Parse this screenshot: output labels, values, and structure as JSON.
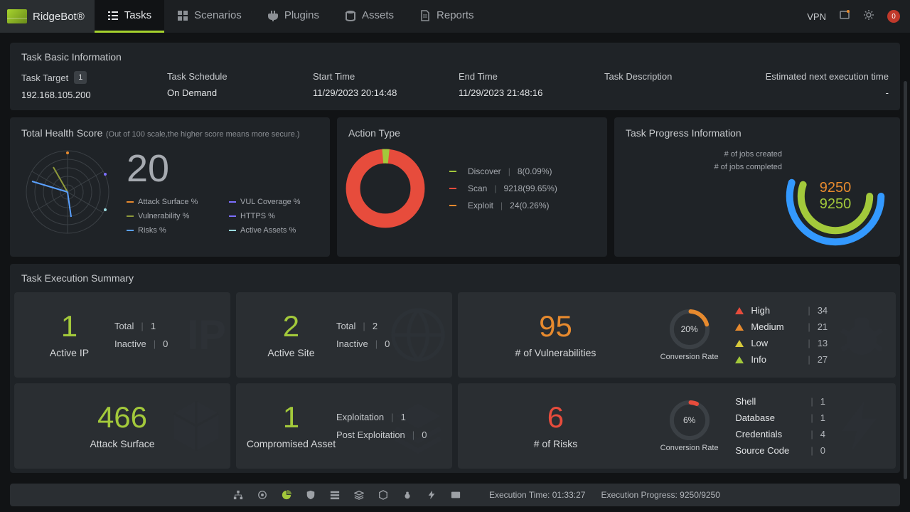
{
  "brand": "RidgeBot®",
  "nav": {
    "tasks": "Tasks",
    "scenarios": "Scenarios",
    "plugins": "Plugins",
    "assets": "Assets",
    "reports": "Reports",
    "vpn": "VPN",
    "avatar_initial": "0"
  },
  "basic": {
    "title": "Task Basic Information",
    "target_label": "Task Target",
    "target_count": "1",
    "target_value": "192.168.105.200",
    "schedule_label": "Task Schedule",
    "schedule_value": "On Demand",
    "start_label": "Start Time",
    "start_value": "11/29/2023 20:14:48",
    "end_label": "End Time",
    "end_value": "11/29/2023 21:48:16",
    "desc_label": "Task Description",
    "desc_value": "",
    "eta_label": "Estimated next execution time",
    "eta_value": "-"
  },
  "health": {
    "title": "Total Health Score",
    "subtitle": "(Out of 100 scale,the higher score means more secure.)",
    "score": "20",
    "legend": {
      "attack_surface": "Attack Surface %",
      "vul_coverage": "VUL Coverage %",
      "vulnerability": "Vulnerability %",
      "https": "HTTPS %",
      "risks": "Risks %",
      "active_assets": "Active Assets %"
    }
  },
  "action": {
    "title": "Action Type",
    "discover_label": "Discover",
    "discover_value": "8(0.09%)",
    "scan_label": "Scan",
    "scan_value": "9218(99.65%)",
    "exploit_label": "Exploit",
    "exploit_value": "24(0.26%)"
  },
  "progress": {
    "title": "Task Progress Information",
    "created_label": "# of jobs created",
    "completed_label": "# of jobs completed",
    "n_created": "9250",
    "n_completed": "9250"
  },
  "exec": {
    "title": "Task Execution Summary",
    "active_ip": {
      "big": "1",
      "label": "Active IP",
      "total_label": "Total",
      "total": "1",
      "inactive_label": "Inactive",
      "inactive": "0"
    },
    "active_site": {
      "big": "2",
      "label": "Active Site",
      "total_label": "Total",
      "total": "2",
      "inactive_label": "Inactive",
      "inactive": "0"
    },
    "vuln": {
      "big": "95",
      "label": "# of Vulnerabilities",
      "conv_pct": "20%",
      "conv_label": "Conversion Rate",
      "high_label": "High",
      "high": "34",
      "medium_label": "Medium",
      "medium": "21",
      "low_label": "Low",
      "low": "13",
      "info_label": "Info",
      "info": "27"
    },
    "attack_surface": {
      "big": "466",
      "label": "Attack Surface"
    },
    "compromised": {
      "big": "1",
      "label": "Compromised Asset",
      "exploit_label": "Exploitation",
      "exploit": "1",
      "post_label": "Post Exploitation",
      "post": "0"
    },
    "risks": {
      "big": "6",
      "label": "# of Risks",
      "conv_pct": "6%",
      "conv_label": "Conversion Rate",
      "shell_label": "Shell",
      "shell": "1",
      "db_label": "Database",
      "db": "1",
      "cred_label": "Credentials",
      "cred": "4",
      "src_label": "Source Code",
      "src": "0"
    }
  },
  "bottom": {
    "exec_time_label": "Execution Time:",
    "exec_time": "01:33:27",
    "progress_label": "Execution Progress:",
    "progress": "9250/9250"
  },
  "chart_data": [
    {
      "type": "pie",
      "title": "Action Type",
      "series": [
        {
          "name": "Discover",
          "value": 8,
          "pct": 0.09,
          "color": "#a3c93b"
        },
        {
          "name": "Scan",
          "value": 9218,
          "pct": 99.65,
          "color": "#e74c3c"
        },
        {
          "name": "Exploit",
          "value": 24,
          "pct": 0.26,
          "color": "#e78a2e"
        }
      ]
    },
    {
      "type": "pie",
      "title": "Task Progress Information",
      "series": [
        {
          "name": "# of jobs created",
          "value": 9250,
          "color": "#3399ff"
        },
        {
          "name": "# of jobs completed",
          "value": 9250,
          "color": "#a3c93b"
        }
      ]
    },
    {
      "type": "bar",
      "title": "Vulnerability severity",
      "categories": [
        "High",
        "Medium",
        "Low",
        "Info"
      ],
      "values": [
        34,
        21,
        13,
        27
      ]
    },
    {
      "type": "bar",
      "title": "Risk categories",
      "categories": [
        "Shell",
        "Database",
        "Credentials",
        "Source Code"
      ],
      "values": [
        1,
        1,
        4,
        0
      ]
    }
  ]
}
